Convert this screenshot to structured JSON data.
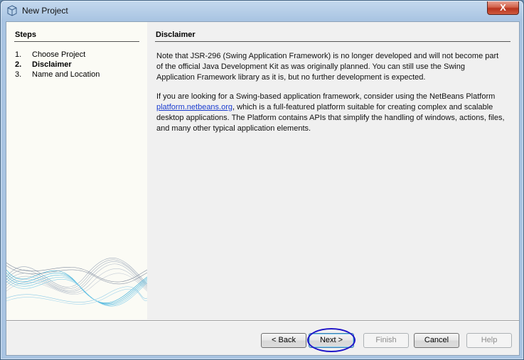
{
  "window": {
    "title": "New Project",
    "close_label": "X"
  },
  "steps": {
    "header": "Steps",
    "items": [
      {
        "num": "1.",
        "label": "Choose Project",
        "active": false
      },
      {
        "num": "2.",
        "label": "Disclaimer",
        "active": true
      },
      {
        "num": "3.",
        "label": "Name and Location",
        "active": false
      }
    ]
  },
  "content": {
    "header": "Disclaimer",
    "para1": "Note that JSR-296 (Swing Application Framework) is no longer developed and will not become part of the official Java Development Kit as was originally planned. You can still use the Swing Application Framework library as it is, but no further development is expected.",
    "para2_before": "If you are looking for a Swing-based application framework, consider using the NetBeans Platform",
    "link": "platform.netbeans.org",
    "para2_after": ", which is a full-featured platform suitable for creating complex and scalable desktop applications. The Platform contains APIs that simplify the handling of windows, actions, files, and many other typical application elements."
  },
  "buttons": {
    "back": "< Back",
    "next": "Next >",
    "finish": "Finish",
    "cancel": "Cancel",
    "help": "Help"
  },
  "colors": {
    "link": "#1a3ccf",
    "highlight": "#2015c8",
    "steps_background": "#fbfbf5",
    "wave_accent": "#2aa7d6"
  }
}
